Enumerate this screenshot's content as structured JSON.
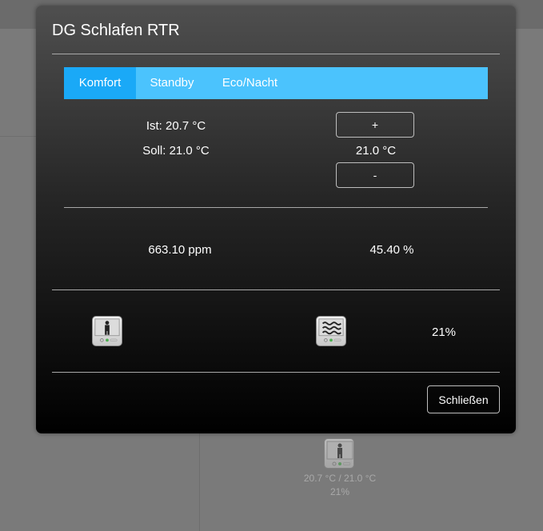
{
  "dialog": {
    "title": "DG Schlafen RTR",
    "tabs": [
      {
        "label": "Komfort",
        "active": true
      },
      {
        "label": "Standby",
        "active": false
      },
      {
        "label": "Eco/Nacht",
        "active": false
      }
    ],
    "ist": "Ist: 20.7 °C",
    "soll": "Soll: 21.0 °C",
    "plus_label": "+",
    "setpoint": "21.0 °C",
    "minus_label": "-",
    "co2": "663.10 ppm",
    "humidity": "45.40 %",
    "presence_icon": "person-icon",
    "heating_icon": "heat-waves-icon",
    "valve_percent": "21%",
    "close_label": "Schließen"
  },
  "background": {
    "tile_icon": "person-icon",
    "temps": "20.7 °C / 21.0 °C",
    "percent": "21%"
  },
  "colors": {
    "tab_bar": "#4bc3fd",
    "tab_active": "#1aa9f7"
  }
}
